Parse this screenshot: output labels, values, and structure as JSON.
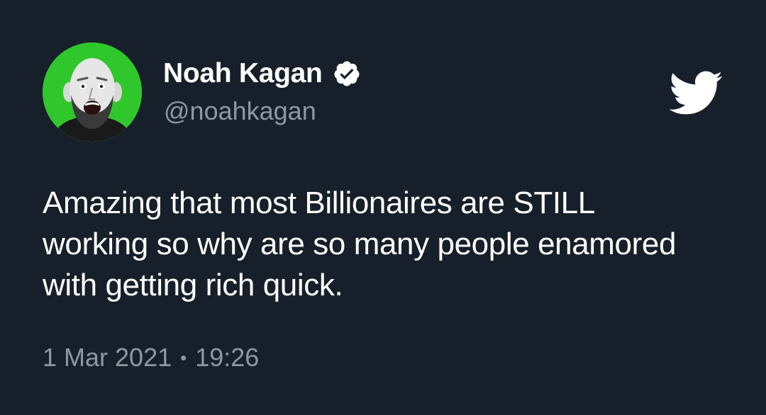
{
  "author": {
    "display_name": "Noah Kagan",
    "handle": "@noahkagan",
    "verified": true,
    "avatar_background": "#2fc72b"
  },
  "tweet": {
    "lines": [
      "Amazing that most Billionaires are STILL",
      "working so why are so many people enamored",
      "with getting rich quick."
    ],
    "date": "1 Mar 2021",
    "separator": "•",
    "time": "19:26"
  },
  "icons": {
    "verified": "verified-badge-icon",
    "brand": "twitter-bird-icon"
  },
  "colors": {
    "background": "#17202a",
    "primary_text": "#ffffff",
    "secondary_text": "#8b98a5"
  }
}
